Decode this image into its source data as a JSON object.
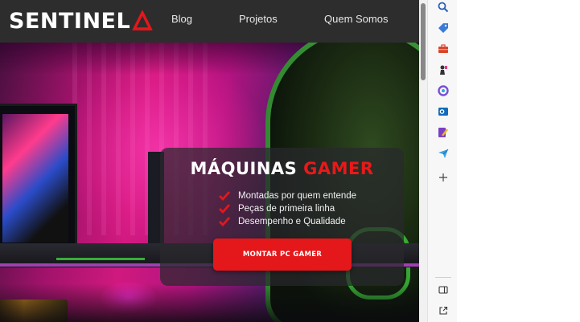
{
  "site": {
    "logo_text": "SENTINEL",
    "nav": [
      {
        "label": "Blog"
      },
      {
        "label": "Projetos"
      },
      {
        "label": "Quem Somos"
      }
    ]
  },
  "hero_card": {
    "title_main": "MÁQUINAS",
    "title_accent": "GAMER",
    "features": [
      "Montadas por quem entende",
      "Peças de primeira linha",
      "Desempenho e Qualidade"
    ],
    "cta_label": "MONTAR PC GAMER"
  },
  "colors": {
    "accent": "#e4171a",
    "navbar": "#2d2d2d"
  },
  "sidebar_icons": [
    "search-icon",
    "tag-icon",
    "toolbox-icon",
    "chess-piece-icon",
    "copilot-icon",
    "outlook-icon",
    "designer-icon",
    "send-icon",
    "add-icon",
    "split-screen-icon",
    "external-link-icon"
  ]
}
